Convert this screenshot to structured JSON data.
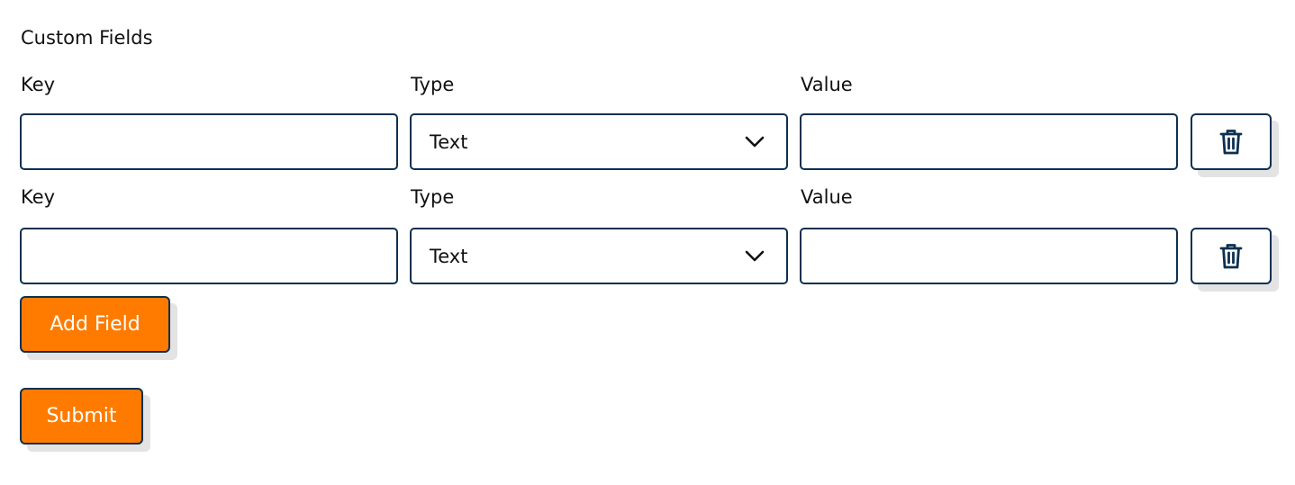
{
  "form": {
    "title": "Custom Fields",
    "rows": [
      {
        "key_label": "Key",
        "type_label": "Type",
        "value_label": "Value",
        "key_value": "",
        "type_value": "Text",
        "value_value": ""
      },
      {
        "key_label": "Key",
        "type_label": "Type",
        "value_label": "Value",
        "key_value": "",
        "type_value": "Text",
        "value_value": ""
      }
    ],
    "add_field_label": "Add Field",
    "submit_label": "Submit"
  },
  "colors": {
    "accent": "#ff7b00",
    "border": "#0d3050"
  },
  "icons": {
    "delete": "trash-icon",
    "dropdown": "chevron-down-icon"
  }
}
